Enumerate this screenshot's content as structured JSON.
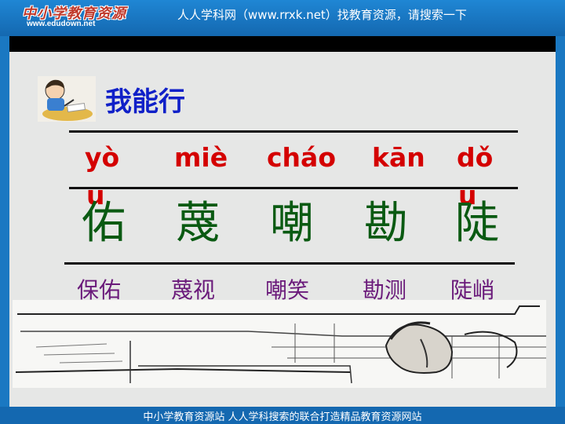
{
  "header": {
    "logo_text": "中小学教育资源",
    "logo_url": "www.edudown.net",
    "banner": "人人学科网（www.rrxk.net）找教育资源，请搜索一下"
  },
  "slide": {
    "title": "我能行",
    "pinyin": [
      {
        "top": "yò",
        "wrap": "u"
      },
      {
        "top": "miè",
        "wrap": ""
      },
      {
        "top": "cháo",
        "wrap": ""
      },
      {
        "top": "kān",
        "wrap": ""
      },
      {
        "top": "dǒ",
        "wrap": "u"
      }
    ],
    "characters": [
      "佑",
      "蔑",
      "嘲",
      "勘",
      "陡"
    ],
    "words": [
      "保佑",
      "蔑视",
      "嘲笑",
      "勘测",
      "陡峭"
    ]
  },
  "footer": {
    "text": "中小学教育资源站 人人学科搜索的联合打造精品教育资源网站"
  },
  "colors": {
    "header_blue": "#1a78c2",
    "title_blue": "#1020c8",
    "pinyin_red": "#d40000",
    "character_green": "#0a5a12",
    "word_purple": "#6a1a7a",
    "slide_bg": "#e6e7e6"
  }
}
